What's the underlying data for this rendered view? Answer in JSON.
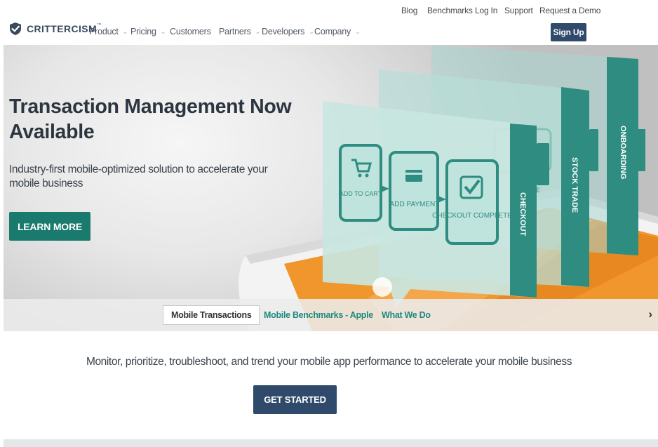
{
  "util_nav": {
    "links": [
      "Blog",
      "Benchmarks",
      "Log In",
      "Support",
      "Request a Demo"
    ]
  },
  "brand": {
    "name": "CRITTERCISM",
    "trademark": "™",
    "icon": "shield-check-icon",
    "color": "#3a4a5e"
  },
  "main_nav": {
    "items": [
      {
        "label": "Product",
        "has_dropdown": true
      },
      {
        "label": "Pricing",
        "has_dropdown": true
      },
      {
        "label": "Customers",
        "has_dropdown": false
      },
      {
        "label": "Partners",
        "has_dropdown": true
      },
      {
        "label": "Developers",
        "has_dropdown": true
      },
      {
        "label": "Company",
        "has_dropdown": true
      }
    ],
    "signup_label": "Sign Up"
  },
  "hero": {
    "title": "Transaction Management Now Available",
    "subtitle": "Industry-first mobile-optimized solution to accelerate your mobile business",
    "cta_label": "LEARN MORE",
    "illustration": {
      "panels": [
        "CHECKOUT",
        "STOCK TRADE",
        "ONBOARDING"
      ],
      "steps": [
        "ADD TO CART",
        "ADD PAYMENT",
        "CHECKOUT COMPLETE"
      ],
      "partial_step_text": [
        "TE",
        "E"
      ]
    },
    "tabs": [
      {
        "label": "Mobile Transactions",
        "active": true
      },
      {
        "label": "Mobile Benchmarks - Apple",
        "active": false
      },
      {
        "label": "What We Do",
        "active": false
      }
    ],
    "next_icon": "chevron-right-icon"
  },
  "tagline": "Monitor, prioritize, troubleshoot, and trend your mobile app performance to accelerate your mobile business",
  "get_started_label": "GET STARTED",
  "colors": {
    "accent_teal": "#1a7a6e",
    "tab_teal": "#1d8a7c",
    "navy": "#2f4a6b",
    "panel_teal": "#2e8c80",
    "tablet_orange": "#f0962c"
  }
}
